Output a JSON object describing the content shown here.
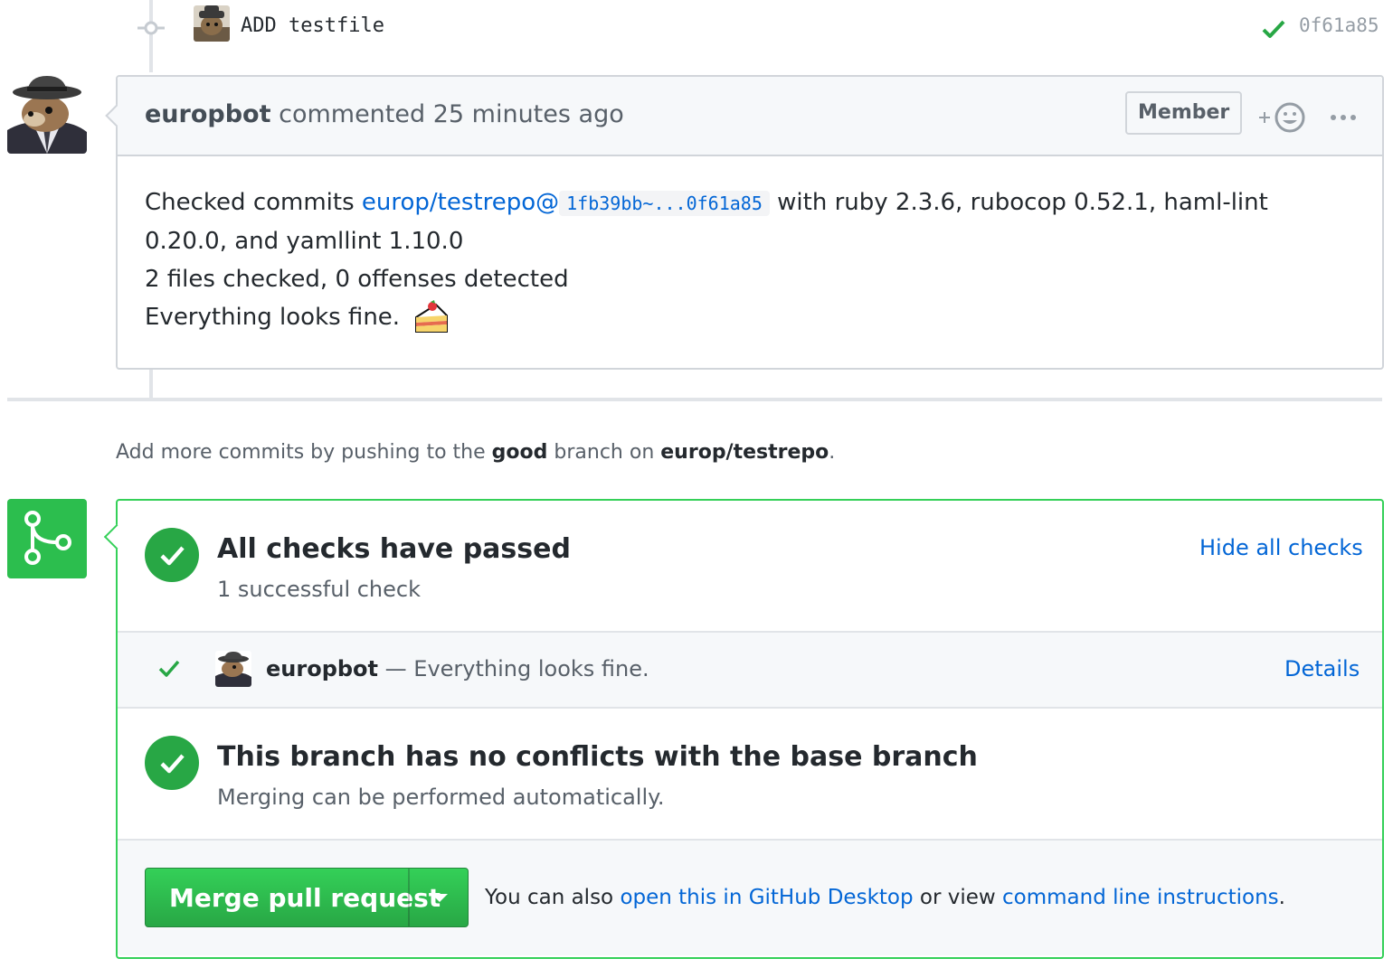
{
  "commit": {
    "message": "ADD testfile",
    "sha": "0f61a85",
    "status_icon": "check-icon"
  },
  "comment": {
    "author": "europbot",
    "action": "commented 25 minutes ago",
    "badge": "Member",
    "reaction_icon": "smiley-icon",
    "more_icon": "kebab-horizontal-icon",
    "body": {
      "prefix": "Checked commits ",
      "repo_link": "europ/testrepo@",
      "range": "1fb39bb~...0f61a85",
      "suffix": " with ruby 2.3.6, rubocop 0.52.1, haml-lint 0.20.0, and yamllint 1.10.0",
      "line2": "2 files checked, 0 offenses detected",
      "line3": "Everything looks fine.",
      "emoji": "cake-emoji"
    }
  },
  "hint": {
    "part1": "Add more commits by pushing to the ",
    "branch": "good",
    "part2": " branch on ",
    "repo": "europ/testrepo",
    "part3": "."
  },
  "checks": {
    "title": "All checks have passed",
    "subtitle": "1 successful check",
    "toggle_link": "Hide all checks",
    "items": [
      {
        "name": "europbot",
        "description": "— Everything looks fine.",
        "details": "Details"
      }
    ]
  },
  "conflicts": {
    "title": "This branch has no conflicts with the base branch",
    "subtitle": "Merging can be performed automatically."
  },
  "merge": {
    "button_label": "Merge pull request",
    "text_before": "You can also ",
    "link1": "open this in GitHub Desktop",
    "text_mid": " or view ",
    "link2": "command line instructions",
    "text_after": "."
  },
  "colors": {
    "success": "#28a745",
    "link": "#0366d6",
    "border": "#d1d5da"
  }
}
